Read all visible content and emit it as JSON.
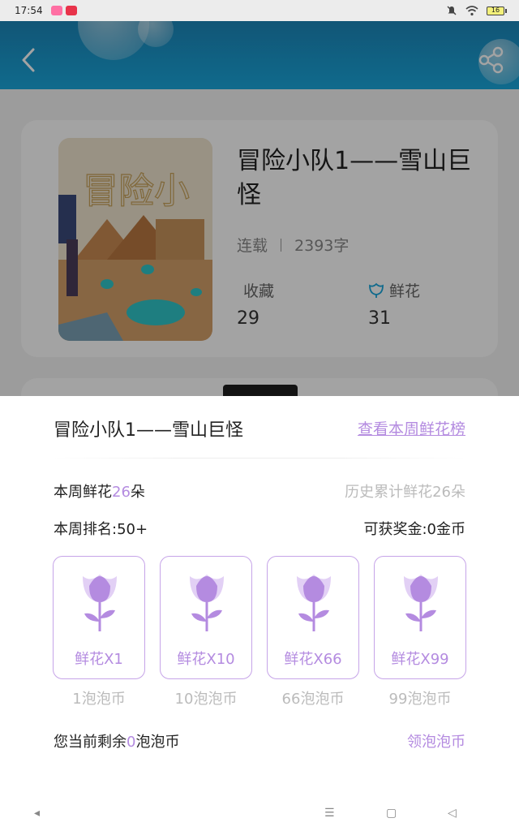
{
  "status_bar": {
    "time": "17:54",
    "battery": "16"
  },
  "header": {
    "back_icon": "chevron-left-icon",
    "share_icon": "share-icon"
  },
  "book": {
    "title": "冒险小队1——雪山巨怪",
    "status": "连载",
    "word_count": "2393字",
    "favorites_label": "收藏",
    "favorites_value": "29",
    "flowers_label": "鲜花",
    "flowers_value": "31",
    "cover_text": "冒险小"
  },
  "sheet": {
    "title": "冒险小队1——雪山巨怪",
    "weekly_link": "查看本周鲜花榜",
    "week_flowers_prefix": "本周鲜花",
    "week_flowers_count": "26",
    "week_flowers_suffix": "朵",
    "history_total": "历史累计鲜花26朵",
    "week_rank": "本周排名:50+",
    "reward": "可获奖金:0金币",
    "options": [
      {
        "label": "鲜花X1",
        "price": "1泡泡币"
      },
      {
        "label": "鲜花X10",
        "price": "10泡泡币"
      },
      {
        "label": "鲜花X66",
        "price": "66泡泡币"
      },
      {
        "label": "鲜花X99",
        "price": "99泡泡币"
      }
    ],
    "balance_prefix": "您当前剩余",
    "balance_value": "0",
    "balance_suffix": "泡泡币",
    "get_coins": "领泡泡币"
  },
  "nav": {
    "back": "◂",
    "menu": "☰",
    "home": "▢",
    "recent": "◁"
  },
  "colors": {
    "accent": "#b48be0",
    "header": "#1aa7dc"
  }
}
